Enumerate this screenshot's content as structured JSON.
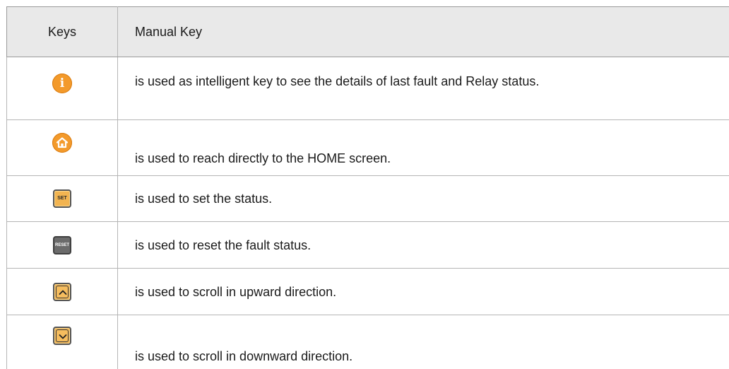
{
  "table": {
    "headers": {
      "keys": "Keys",
      "description": "Manual Key"
    },
    "rows": [
      {
        "icon": "info-icon",
        "icon_glyph": "i",
        "description": "is used as intelligent key to see the details of last fault and Relay status."
      },
      {
        "icon": "home-icon",
        "description": "is used to reach directly to the HOME screen."
      },
      {
        "icon": "set-key-icon",
        "key_label": "SET",
        "description": "is used to set the status."
      },
      {
        "icon": "reset-key-icon",
        "key_label": "RESET",
        "description": "is used to reset the fault status."
      },
      {
        "icon": "chevron-up-icon",
        "description": "is used to scroll in upward direction."
      },
      {
        "icon": "chevron-down-icon",
        "description": "is used to scroll in downward direction."
      }
    ]
  },
  "colors": {
    "orange_key": "#f39a2b",
    "amber_key": "#f2b451",
    "dark_key": "#6b6b6b",
    "header_bg": "#e9e9e9"
  }
}
